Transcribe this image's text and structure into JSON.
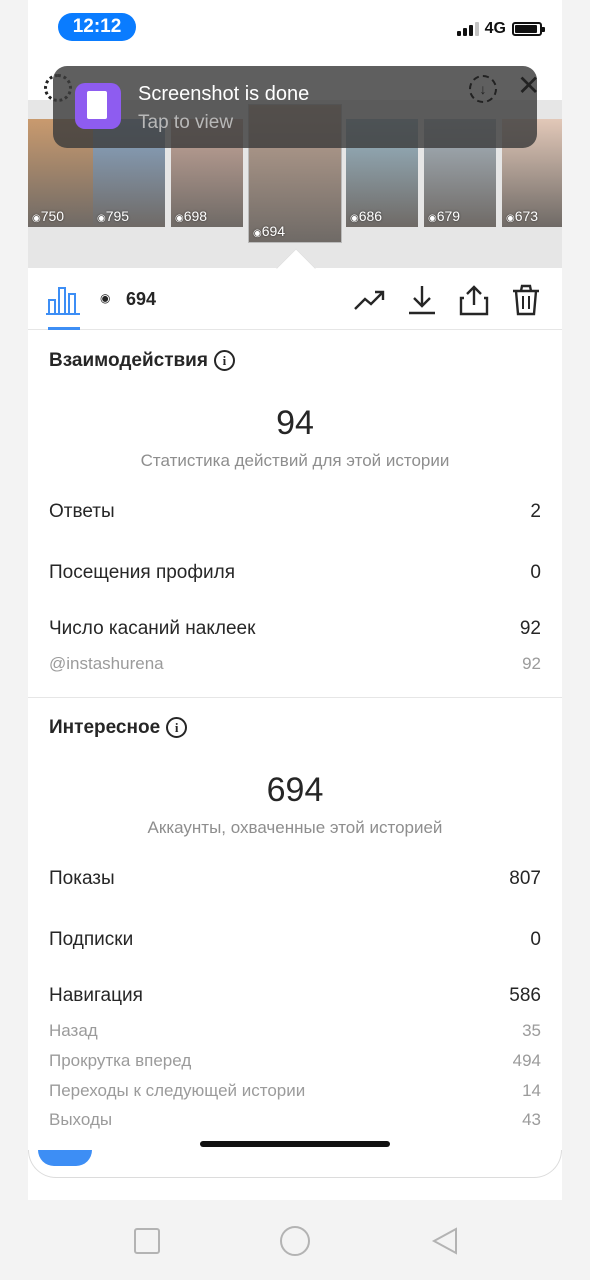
{
  "status": {
    "time": "12:12",
    "network": "4G"
  },
  "toast": {
    "title": "Screenshot is done",
    "subtitle": "Tap to view"
  },
  "stories": [
    {
      "views": "750",
      "color": "#c99a6e"
    },
    {
      "views": "795",
      "color": "#8aa8c8"
    },
    {
      "views": "698",
      "color": "#c7a79a"
    },
    {
      "views": "694",
      "color": "#bfa594",
      "selected": true
    },
    {
      "views": "686",
      "color": "#9ab8c8"
    },
    {
      "views": "679",
      "color": "#a9b6c0"
    },
    {
      "views": "673",
      "color": "#e2c8b8"
    }
  ],
  "tabbar": {
    "views": "694"
  },
  "interactions": {
    "title": "Взаимодействия",
    "total": "94",
    "caption": "Статистика действий для этой истории",
    "rows": [
      {
        "label": "Ответы",
        "value": "2"
      },
      {
        "label": "Посещения профиля",
        "value": "0"
      },
      {
        "label": "Число касаний наклеек",
        "value": "92"
      }
    ],
    "sticker": {
      "label": "@instashurena",
      "value": "92"
    }
  },
  "discovery": {
    "title": "Интересное",
    "total": "694",
    "caption": "Аккаунты, охваченные этой историей",
    "rows": [
      {
        "label": "Показы",
        "value": "807"
      },
      {
        "label": "Подписки",
        "value": "0"
      },
      {
        "label": "Навигация",
        "value": "586"
      }
    ],
    "nav_rows": [
      {
        "label": "Назад",
        "value": "35"
      },
      {
        "label": "Прокрутка вперед",
        "value": "494"
      },
      {
        "label": "Переходы к следующей истории",
        "value": "14"
      },
      {
        "label": "Выходы",
        "value": "43"
      }
    ]
  }
}
